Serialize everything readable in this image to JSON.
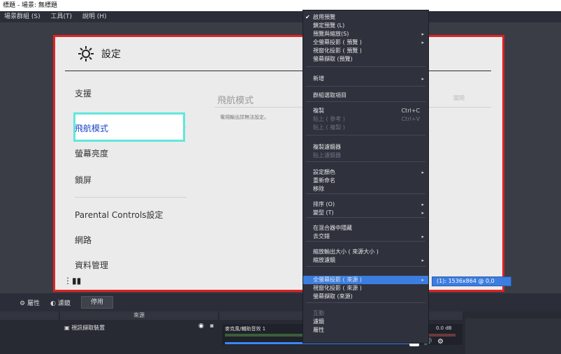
{
  "window": {
    "title": "標題 - 場景: 無標題",
    "menus": [
      "場景群組 (S)",
      "工具(T)",
      "說明 (H)"
    ]
  },
  "switch_settings": {
    "title": "設定",
    "sidebar": [
      "支援",
      "飛航模式",
      "螢幕亮度",
      "鎖屏",
      "Parental Controls設定",
      "網路",
      "資料管理"
    ],
    "selected": "飛航模式",
    "pane_title": "飛航模式",
    "pane_hint": "電視輸出詳無法設定。",
    "pane_button": "關閉"
  },
  "toolbar": {
    "properties": "屬性",
    "filters": "濾鏡",
    "disable": "停用"
  },
  "panels": {
    "sources_header": "來源",
    "source_item": "視訊擷取裝置",
    "mixer_label": "麥克風/輔助音效 1",
    "mixer_db": "0.0 dB"
  },
  "context_menu": {
    "items": [
      {
        "label": "啟用預覽",
        "checked": true
      },
      {
        "label": "鎖定預覽 (L)"
      },
      {
        "label": "預覽與縮放(S)",
        "submenu": true
      },
      {
        "label": "全螢幕投影 ( 預覽 )",
        "submenu": true
      },
      {
        "label": "視窗化投影 ( 預覽 )"
      },
      {
        "label": "螢幕擷取 (預覽)"
      },
      {
        "label": "新增",
        "submenu": true
      },
      {
        "label": "群組選取項目"
      },
      {
        "label": "複製",
        "shortcut": "Ctrl+C"
      },
      {
        "label": "貼上 ( 參考 )",
        "shortcut": "Ctrl+V",
        "disabled": true
      },
      {
        "label": "貼上 ( 複製 )",
        "disabled": true
      },
      {
        "label": "複製濾鏡器"
      },
      {
        "label": "貼上濾鏡器",
        "disabled": true
      },
      {
        "label": "設定顏色",
        "submenu": true
      },
      {
        "label": "重新命名"
      },
      {
        "label": "移除"
      },
      {
        "label": "排序 (O)",
        "submenu": true
      },
      {
        "label": "變型 (T)",
        "submenu": true
      },
      {
        "label": "在混合器中隱藏"
      },
      {
        "label": "去交錯",
        "submenu": true
      },
      {
        "label": "縮放輸出大小 ( 來源大小 )"
      },
      {
        "label": "縮放濾鏡",
        "submenu": true
      },
      {
        "label": "全螢幕投影 ( 來源 )",
        "submenu": true,
        "highlighted": true
      },
      {
        "label": "視窗化投影 ( 來源 )"
      },
      {
        "label": "螢幕擷取 (來源)"
      },
      {
        "label": "互動",
        "disabled": true
      },
      {
        "label": "濾鏡"
      },
      {
        "label": "屬性"
      }
    ],
    "submenu_item": "(1): 1536x864 @ 0,0"
  },
  "colors": {
    "scene_border": "#e02222",
    "highlight": "#3c7de0",
    "selection_outline": "#5fe8dc"
  }
}
